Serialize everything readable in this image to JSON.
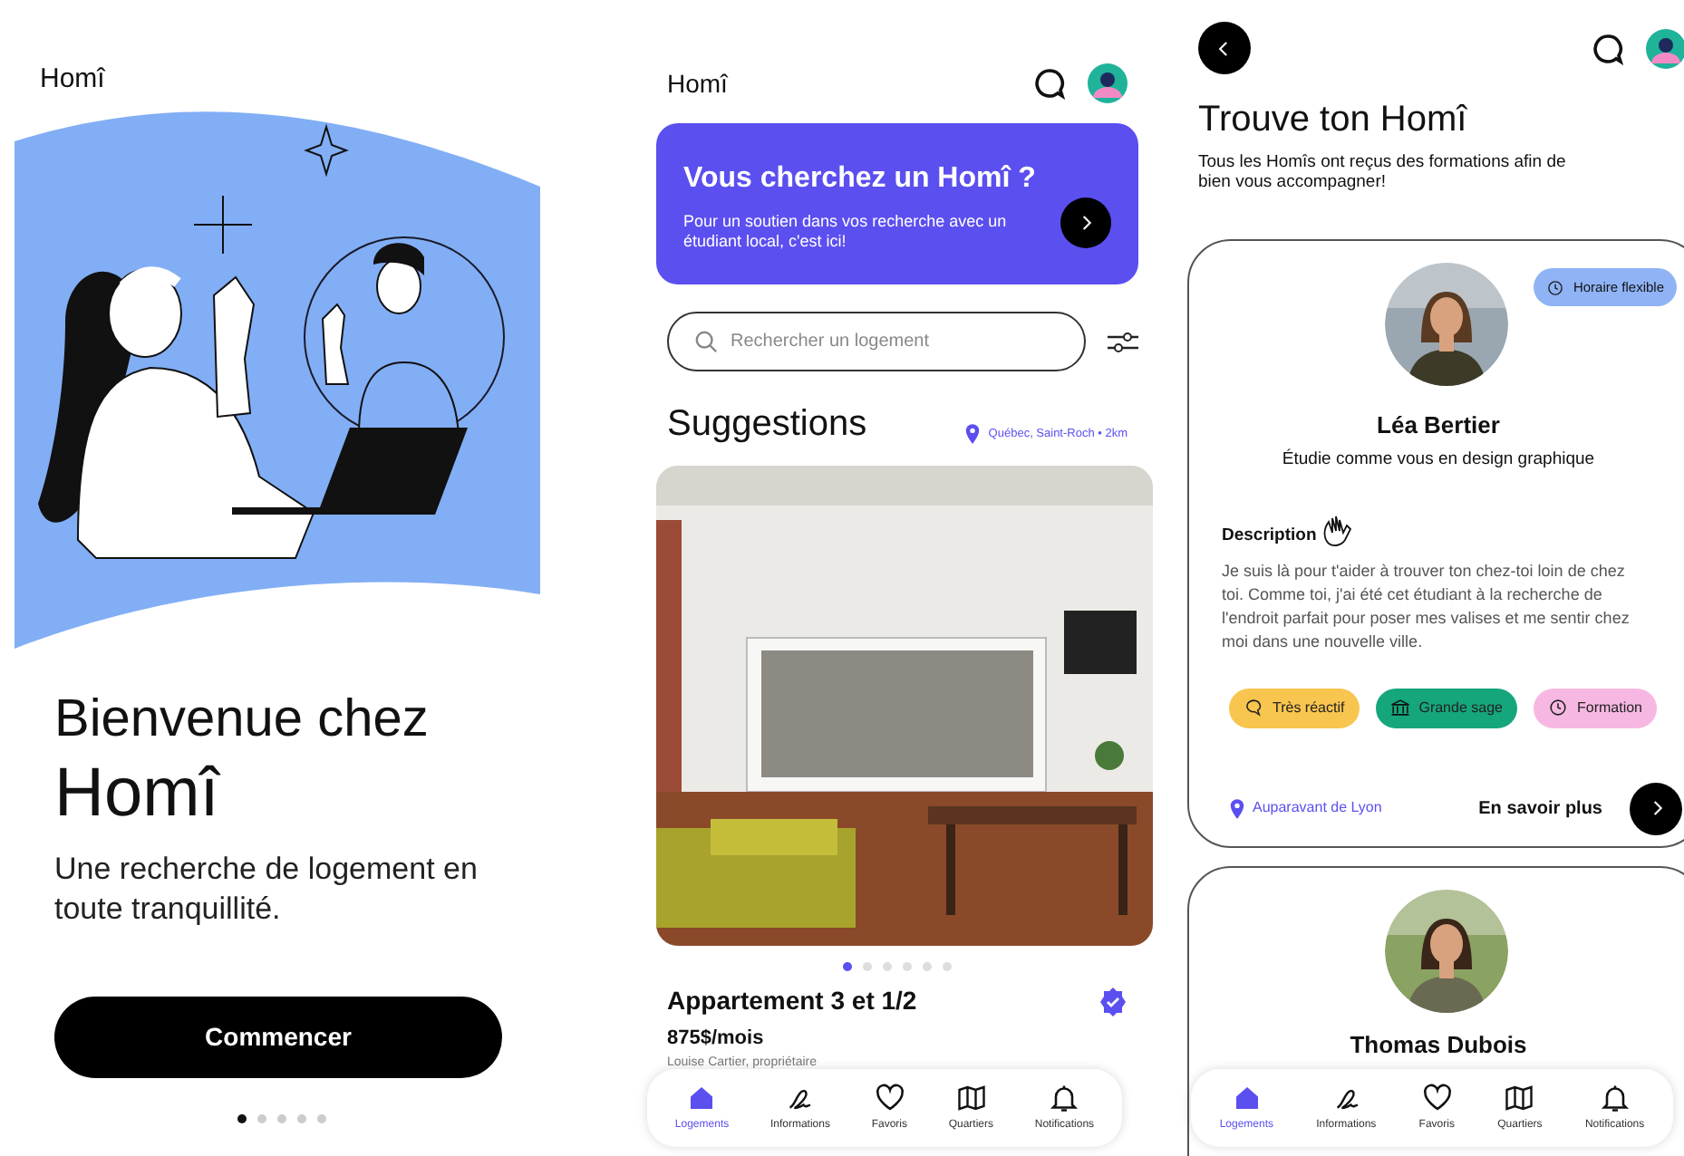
{
  "welcome": {
    "logo": "Homî",
    "title": "Bienvenue chez",
    "brand": "Homî",
    "subtitle": "Une recherche de logement en toute tranquillité.",
    "button": "Commencer",
    "page_dots": [
      {
        "selected": true
      },
      {
        "selected": false
      },
      {
        "selected": false
      },
      {
        "selected": false
      },
      {
        "selected": false
      }
    ]
  },
  "home": {
    "logo": "Homî",
    "banner": {
      "title": "Vous cherchez un Homî ?",
      "text": "Pour un soutien dans vos recherche avec un étudiant local, c'est ici!"
    },
    "search": {
      "placeholder": "Rechercher un logement"
    },
    "section_title": "Suggestions",
    "location": "Québec, Saint-Roch • 2km",
    "carousel_dots": [
      {
        "selected": true
      },
      {
        "selected": false
      },
      {
        "selected": false
      },
      {
        "selected": false
      },
      {
        "selected": false
      },
      {
        "selected": false
      }
    ],
    "listing": {
      "title": "Appartement 3 et 1/2",
      "price": "875$/mois",
      "owner": "Louise Cartier, propriétaire",
      "verified": true
    },
    "nav": [
      {
        "label": "Logements",
        "selected": true
      },
      {
        "label": "Informations",
        "selected": false
      },
      {
        "label": "Favoris",
        "selected": false
      },
      {
        "label": "Quartiers",
        "selected": false
      },
      {
        "label": "Notifications",
        "selected": false
      }
    ]
  },
  "homis": {
    "title": "Trouve ton Homî",
    "subtitle": "Tous les Homîs ont reçus des formations afin de bien vous accompagner!",
    "cards": [
      {
        "badge": "Horaire flexible",
        "name": "Léa Bertier",
        "study": "Étudie comme vous en design graphique",
        "description_label": "Description",
        "description": "Je suis là pour t'aider à trouver ton chez-toi loin de chez toi. Comme toi, j'ai été cet étudiant à la recherche de l'endroit parfait pour poser mes valises et me sentir chez moi dans une nouvelle ville.",
        "tags": [
          {
            "label": "Très réactif",
            "kind": "chat",
            "color": "#f8c54e"
          },
          {
            "label": "Grande sage",
            "kind": "bank",
            "color": "#16a67c"
          },
          {
            "label": "Formation",
            "kind": "clock",
            "color": "#f6b8e2"
          }
        ],
        "origin": "Auparavant de Lyon",
        "more": "En savoir plus"
      },
      {
        "name": "Thomas Dubois"
      }
    ],
    "nav": [
      {
        "label": "Logements",
        "selected": true
      },
      {
        "label": "Informations",
        "selected": false
      },
      {
        "label": "Favoris",
        "selected": false
      },
      {
        "label": "Quartiers",
        "selected": false
      },
      {
        "label": "Notifications",
        "selected": false
      }
    ]
  }
}
